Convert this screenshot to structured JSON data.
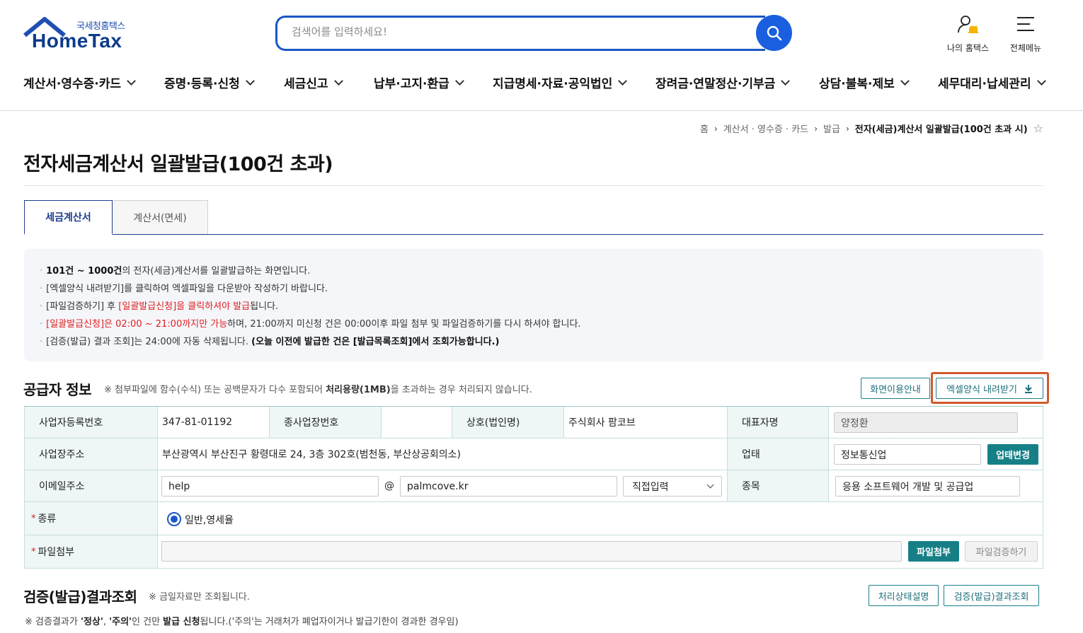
{
  "header": {
    "logo_sub": "국세청홈택스",
    "logo_main": "HomeTax",
    "search_placeholder": "검색어를 입력하세요!",
    "my_hometax": "나의 홈택스",
    "all_menu": "전체메뉴"
  },
  "gnb": [
    "계산서·영수증·카드",
    "증명·등록·신청",
    "세금신고",
    "납부·고지·환급",
    "지급명세·자료·공익법인",
    "장려금·연말정산·기부금",
    "상담·불복·제보",
    "세무대리·납세관리"
  ],
  "breadcrumb": {
    "home": "홈",
    "level1": "계산서 · 영수증 · 카드",
    "level2": "발급",
    "current": "전자(세금)계산서 일괄발급(100건 초과 시)"
  },
  "page_title": "전자세금계산서 일괄발급(100건 초과)",
  "tabs": [
    "세금계산서",
    "계산서(면세)"
  ],
  "info": {
    "l1_bold": "101건 ~ 1000건",
    "l1_rest": "의 전자(세금)계산서를 일괄발급하는 화면입니다.",
    "l2": "[엑셀양식 내려받기]를 클릭하여 엑셀파일을 다운받아 작성하기 바랍니다.",
    "l3_pre": "[파일검증하기] 후 ",
    "l3_red": "[일괄발급신청]을 클릭하셔야 발급",
    "l3_post": "됩니다.",
    "l4_red": "[일괄발급신청]은 02:00 ~ 21:00까지만 가능",
    "l4_rest": "하며, 21:00까지 미신청 건은 00:00이후 파일 첨부 및 파일검증하기를 다시 하셔야 합니다.",
    "l5_pre": "[검증(발급) 결과 조회]는 24:00에 자동 삭제됩니다. ",
    "l5_bold": "(오늘 이전에 발급한 건은 [발급목록조회]에서 조회가능합니다.)"
  },
  "supplier": {
    "title": "공급자 정보",
    "note_pre": "※ 첨부파일에 함수(수식) 또는 공백문자가 다수 포함되어 ",
    "note_bold": "처리용량(1MB)",
    "note_post": "을 초과하는 경우 처리되지 않습니다.",
    "btn_guide": "화면이용안내",
    "btn_excel": "엑셀양식 내려받기",
    "labels": {
      "biz_no": "사업자등록번호",
      "sub_biz_no": "종사업장번호",
      "company": "상호(법인명)",
      "ceo": "대표자명",
      "address": "사업장주소",
      "biz_type": "업태",
      "email": "이메일주소",
      "item": "종목",
      "kind": "종류",
      "file": "파일첨부"
    },
    "values": {
      "biz_no": "347-81-01192",
      "sub_biz_no": "",
      "company": "주식회사 팜코브",
      "ceo": "양정환",
      "address": "부산광역시 부산진구 황령대로 24, 3층 302호(범천동, 부산상공회의소)",
      "biz_type": "정보통신업",
      "email_id": "help",
      "email_at": "@",
      "email_domain": "palmcove.kr",
      "email_select": "직접입력",
      "item": "응용 소프트웨어 개발 및 공급업",
      "kind_option": "일반,영세율"
    },
    "btn_biz_change": "업태변경",
    "btn_attach": "파일첨부",
    "btn_verify": "파일검증하기",
    "required_mark": "*"
  },
  "result": {
    "title": "검증(발급)결과조회",
    "note": "※ 금일자료만 조회됩니다.",
    "btn_status": "처리상태설명",
    "btn_query": "검증(발급)결과조회",
    "bottom_pre": "※ 검증결과가 ",
    "bottom_b1": "'정상'",
    "bottom_mid1": ", ",
    "bottom_b2": "'주의'",
    "bottom_mid2": "인 건만 ",
    "bottom_b3": "발급 신청",
    "bottom_post": "됩니다.('주의'는 거래처가 폐업자이거나 발급기한이 경과한 경우임)"
  }
}
